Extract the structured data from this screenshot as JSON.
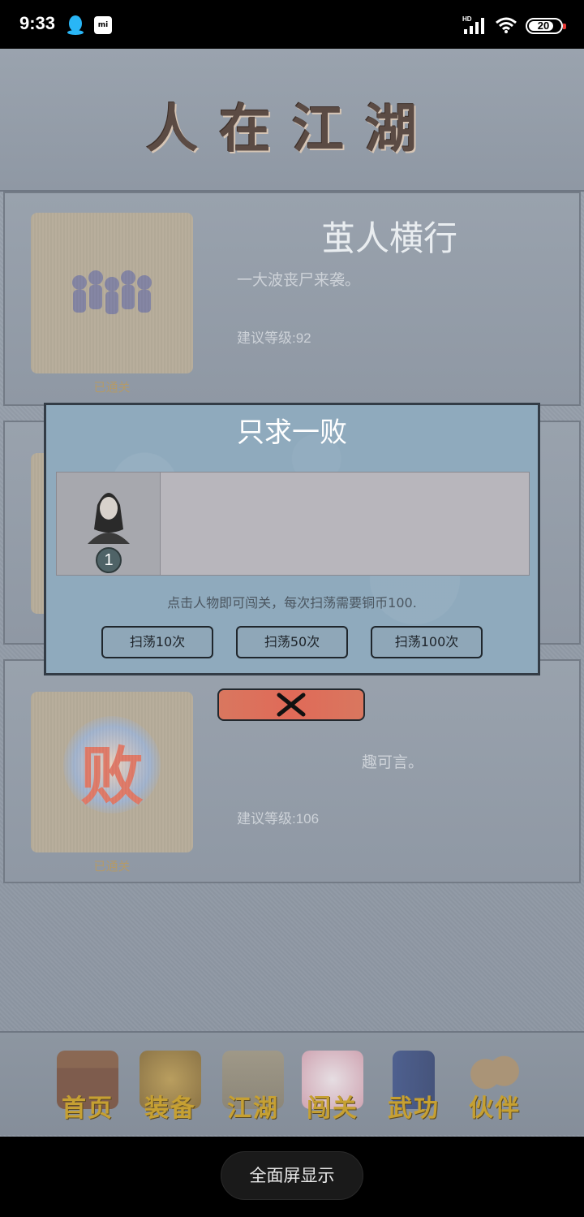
{
  "status_bar": {
    "time": "9:33",
    "battery": "20",
    "network": "HD"
  },
  "header": {
    "title": "人在江湖"
  },
  "stages": [
    {
      "name": "茧人横行",
      "desc": "一大波丧尸来袭。",
      "level": "建议等级:92",
      "status": "已通关"
    },
    {
      "name": "",
      "desc": "趣可言。",
      "level": "建议等级:106",
      "status": "已通关",
      "thumb_glyph": "败"
    }
  ],
  "dialog": {
    "title": "只求一败",
    "character_count": "1",
    "hint": "点击人物即可闯关，每次扫荡需要铜币100.",
    "buttons": [
      "扫荡10次",
      "扫荡50次",
      "扫荡100次"
    ]
  },
  "bottom_nav": {
    "items": [
      "首页",
      "装备",
      "江湖",
      "闯关",
      "武功",
      "伙伴"
    ]
  },
  "system": {
    "fullscreen_label": "全面屏显示"
  },
  "colors": {
    "dialog_bg": "#8faabd",
    "close_button": "#e06a58",
    "nav_label": "#c6a032"
  }
}
